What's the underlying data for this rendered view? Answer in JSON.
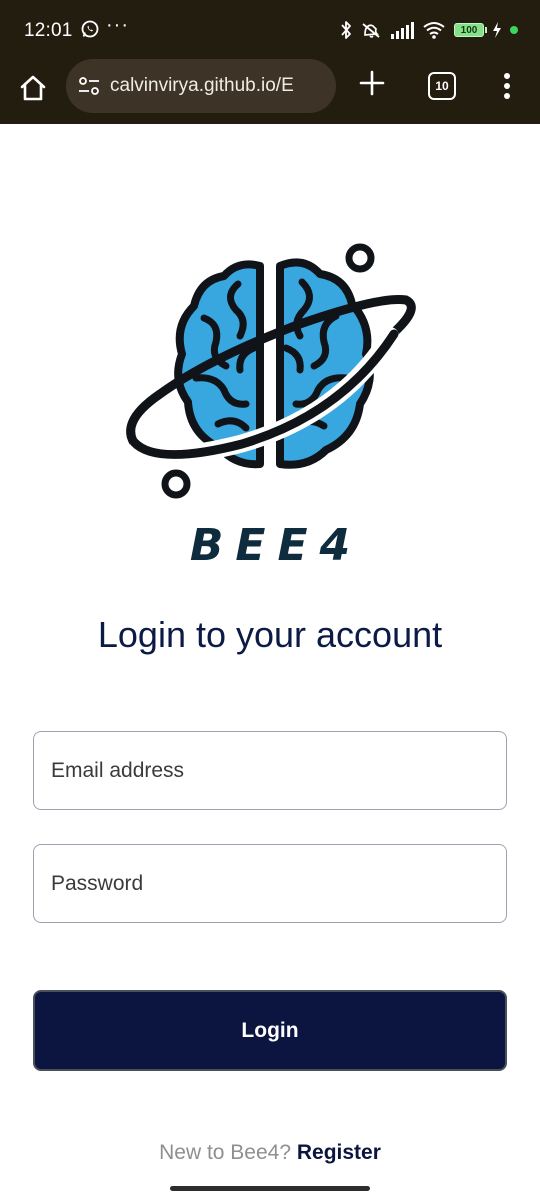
{
  "status_bar": {
    "time": "12:01",
    "overflow": "···",
    "battery": "100",
    "icons": [
      "whatsapp-icon",
      "bluetooth-icon",
      "mute-icon",
      "signal-icon",
      "wifi-icon",
      "battery-icon",
      "charging-icon"
    ]
  },
  "browser": {
    "url": "calvinvirya.github.io/E",
    "tab_count": "10",
    "icons": [
      "home-icon",
      "site-settings-icon",
      "new-tab-icon",
      "tabs-icon",
      "menu-icon"
    ]
  },
  "page": {
    "brand": "BEE4",
    "heading": "Login to your account",
    "email": {
      "placeholder": "Email address",
      "value": ""
    },
    "password": {
      "placeholder": "Password",
      "value": ""
    },
    "login_label": "Login",
    "register_prompt": "New to Bee4?",
    "register_link": "Register"
  },
  "colors": {
    "chrome_bg": "#231d10",
    "url_pill": "#3d3427",
    "brand_text": "#0f2b3e",
    "heading": "#0c1a46",
    "button_bg": "#0c1540",
    "brain_blue": "#38a7e0"
  }
}
